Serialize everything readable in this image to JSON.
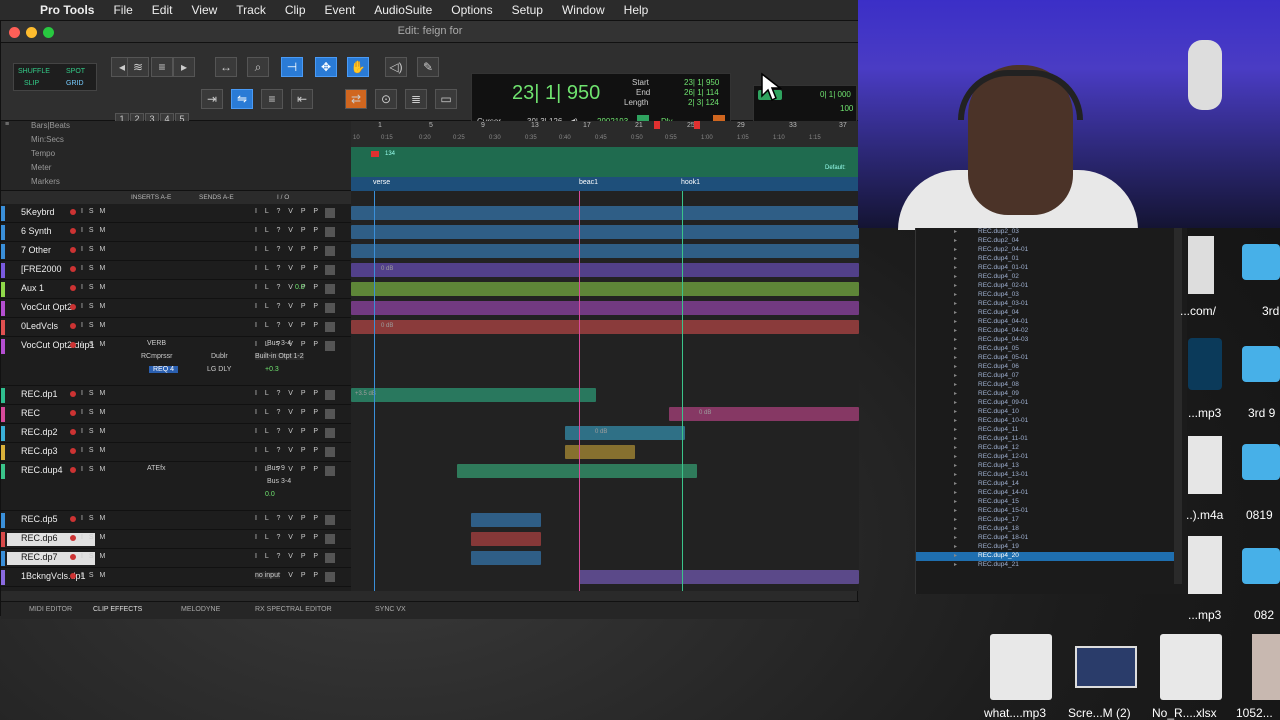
{
  "menubar": {
    "app": "Pro Tools",
    "items": [
      "File",
      "Edit",
      "View",
      "Track",
      "Clip",
      "Event",
      "AudioSuite",
      "Options",
      "Setup",
      "Window",
      "Help"
    ]
  },
  "window": {
    "title": "Edit: feign for"
  },
  "toolbar": {
    "mode_shuffle": "SHUFFLE",
    "mode_spot": "SPOT",
    "mode_slip": "SLIP",
    "mode_grid": "GRID",
    "zoom_presets": [
      "1",
      "2",
      "3",
      "4",
      "5"
    ]
  },
  "counter": {
    "main": "23| 1| 950",
    "start_label": "Start",
    "end_label": "End",
    "length_label": "Length",
    "start_val": "23| 1| 950",
    "end_val": "26| 1| 114",
    "length_val": "2| 3| 124",
    "cursor_label": "Cursor",
    "cursor_val": "30| 3| 126",
    "sample_val": "2902193",
    "dly_label": "Dly",
    "grid_val": "0| 1| 000",
    "nudge_val": "100"
  },
  "rulers": {
    "labels": [
      "Bars|Beats",
      "Min:Secs",
      "Tempo",
      "Meter",
      "Markers"
    ],
    "bars": [
      "1",
      "5",
      "9",
      "13",
      "17",
      "21",
      "25",
      "29",
      "33",
      "37"
    ],
    "mins": [
      "0:15",
      "0:20",
      "0:25",
      "0:30",
      "0:35",
      "0:40",
      "0:45",
      "0:50",
      "0:55",
      "1:00",
      "1:05",
      "1:10",
      "1:15"
    ],
    "start_min": "10",
    "tempo_val": "134",
    "default_label": "Default:",
    "markers": [
      "verse",
      "beac1",
      "hook1"
    ]
  },
  "track_header": {
    "inserts": "INSERTS A-E",
    "sends": "SENDS A-E",
    "io": "I / O"
  },
  "tracks": [
    {
      "name": "5Keybrd",
      "color": "#3a8fd9"
    },
    {
      "name": "6 Synth",
      "color": "#3a8fd9"
    },
    {
      "name": "7 Other",
      "color": "#3a8fd9"
    },
    {
      "name": "[FRE2000",
      "color": "#7a5adf"
    },
    {
      "name": "Aux 1",
      "color": "#8fd94a",
      "vol": "0.0"
    },
    {
      "name": "VocCut Opt2",
      "color": "#b44fd0"
    },
    {
      "name": "0LedVcls",
      "color": "#e05050"
    },
    {
      "name": "VocCut Opt2.dup1",
      "color": "#b44fd0",
      "ins1": "VERB",
      "ins2": "Dublr",
      "ins3": "LG DLY",
      "rcmp": "RCmprssr",
      "req": "REQ 4",
      "bus": "Bus 3-4",
      "io2": "Built-in Otpt 1-2",
      "vol": "+0.3"
    },
    {
      "name": "REC.dp1",
      "color": "#2fbf8f"
    },
    {
      "name": "REC",
      "color": "#d84a9a"
    },
    {
      "name": "REC.dp2",
      "color": "#3ab0d9"
    },
    {
      "name": "REC.dp3",
      "color": "#d9b03a"
    },
    {
      "name": "REC.dup4",
      "color": "#3ac48a",
      "ins1": "ATEfx",
      "bus": "Bus 9",
      "bus2": "Bus 3-4",
      "vol": "0.0"
    },
    {
      "name": "REC.dp5",
      "color": "#3a8fd9"
    },
    {
      "name": "REC.dp6",
      "color": "#d84a4a"
    },
    {
      "name": "REC.dp7",
      "color": "#3a8fd9"
    },
    {
      "name": "1BckngVcls.dp1",
      "color": "#8a6adf",
      "io2": "no input"
    }
  ],
  "clip_labels": [
    "0 dB",
    "+3.5 dB"
  ],
  "editbar": {
    "items": [
      "MIDI EDITOR",
      "CLIP EFFECTS",
      "MELODYNE",
      "RX SPECTRAL EDITOR",
      "SYNC VX"
    ]
  },
  "finder": {
    "rows": [
      "REC.dup2_03",
      "REC.dup2_04",
      "REC.dup2_04-01",
      "REC.dup4_01",
      "REC.dup4_01-01",
      "REC.dup4_02",
      "REC.dup4_02-01",
      "REC.dup4_03",
      "REC.dup4_03-01",
      "REC.dup4_04",
      "REC.dup4_04-01",
      "REC.dup4_04-02",
      "REC.dup4_04-03",
      "REC.dup4_05",
      "REC.dup4_05-01",
      "REC.dup4_06",
      "REC.dup4_07",
      "REC.dup4_08",
      "REC.dup4_09",
      "REC.dup4_09-01",
      "REC.dup4_10",
      "REC.dup4_10-01",
      "REC.dup4_11",
      "REC.dup4_11-01",
      "REC.dup4_12",
      "REC.dup4_12-01",
      "REC.dup4_13",
      "REC.dup4_13-01",
      "REC.dup4_14",
      "REC.dup4_14-01",
      "REC.dup4_15",
      "REC.dup4_15-01",
      "REC.dup4_17",
      "REC.dup4_18",
      "REC.dup4_18-01",
      "REC.dup4_19",
      "REC.dup4_20",
      "REC.dup4_21"
    ],
    "selected": "REC.dup4_20"
  },
  "desktop": {
    "labels": [
      "...com/",
      "3rd",
      "...mp3",
      "3rd 9",
      "..).m4a",
      "0819",
      "...mp3",
      "082",
      "what....mp3",
      "Scre...M (2)",
      "No_R....xlsx",
      "1052..."
    ]
  }
}
